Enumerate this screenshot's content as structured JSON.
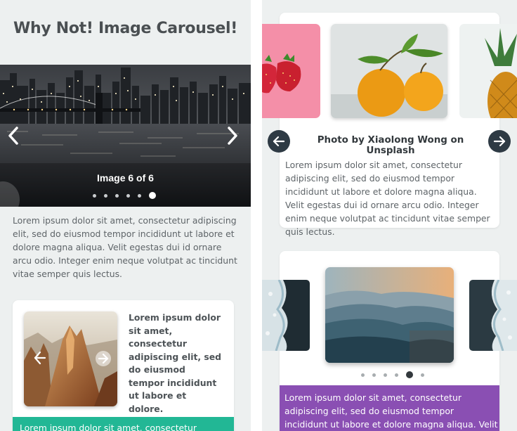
{
  "left": {
    "title": "Why Not! Image Carousel!",
    "hero": {
      "caption": "Image 6 of 6",
      "slide_count": 6,
      "active_index": 6
    },
    "lorem": "Lorem ipsum dolor sit amet, consectetur adipiscing elit, sed do eiusmod tempor incididunt ut labore et dolore magna aliqua. Velit egestas dui id ornare arcu odio. Integer enim neque volutpat ac tincidunt vitae semper quis lectus.",
    "card": {
      "text": "Lorem ipsum dolor sit amet, consectetur adipiscing elit, sed do eiusmod tempor incididunt ut labore et dolore."
    },
    "teal_bar_text": "Lorem ipsum dolor sit amet, consectetur"
  },
  "right": {
    "card1": {
      "caption": "Photo by Xiaolong Wong on Unsplash",
      "lorem": "Lorem ipsum dolor sit amet, consectetur adipiscing elit, sed do eiusmod tempor incididunt ut labore et dolore magna aliqua. Velit egestas dui id ornare arcu odio. Integer enim neque volutpat ac tincidunt vitae semper quis lectus."
    },
    "card2": {
      "slide_count": 6,
      "active_index": 5,
      "purple_text": "Lorem ipsum dolor sit amet, consectetur adipiscing elit, sed do eiusmod tempor incididunt ut labore et dolore magna aliqua. Velit egestas"
    }
  },
  "colors": {
    "panel_bg": "#edf0f0",
    "teal": "#22b795",
    "purple": "#8a4fb3",
    "dark_button": "#2e3a44"
  },
  "icons": {
    "hero_prev": "chevron-left-icon",
    "hero_next": "chevron-right-icon",
    "card_prev": "arrow-left-icon",
    "card_next": "arrow-right-circle-icon",
    "circle_prev": "arrow-left-icon",
    "circle_next": "arrow-right-icon"
  }
}
